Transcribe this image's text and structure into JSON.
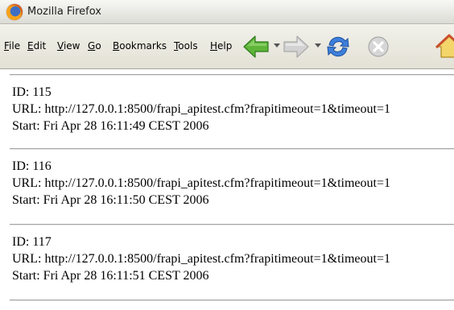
{
  "window": {
    "title": "Mozilla Firefox"
  },
  "menu": {
    "items": [
      {
        "accel": "F",
        "rest": "ile"
      },
      {
        "accel": "E",
        "rest": "dit"
      },
      {
        "accel": "V",
        "rest": "iew"
      },
      {
        "accel": "G",
        "rest": "o"
      },
      {
        "accel": "B",
        "rest": "ookmarks"
      },
      {
        "accel": "T",
        "rest": "ools"
      },
      {
        "accel": "H",
        "rest": "elp"
      }
    ]
  },
  "toolbar": {
    "back_icon": "back-arrow-icon",
    "forward_icon": "forward-arrow-icon",
    "reload_icon": "reload-icon",
    "stop_icon": "stop-icon",
    "home_icon": "home-icon"
  },
  "entries": [
    {
      "id": "ID: 115",
      "url": "URL: http://127.0.0.1:8500/frapi_apitest.cfm?frapitimeout=1&timeout=1",
      "start": "Start: Fri Apr 28 16:11:49 CEST 2006"
    },
    {
      "id": "ID: 116",
      "url": "URL: http://127.0.0.1:8500/frapi_apitest.cfm?frapitimeout=1&timeout=1",
      "start": "Start: Fri Apr 28 16:11:50 CEST 2006"
    },
    {
      "id": "ID: 117",
      "url": "URL: http://127.0.0.1:8500/frapi_apitest.cfm?frapitimeout=1&timeout=1",
      "start": "Start: Fri Apr 28 16:11:51 CEST 2006"
    }
  ],
  "colors": {
    "back_green": "#5fb53a",
    "forward_gray": "#c9c9c9",
    "reload_blue": "#2f6fd0"
  }
}
